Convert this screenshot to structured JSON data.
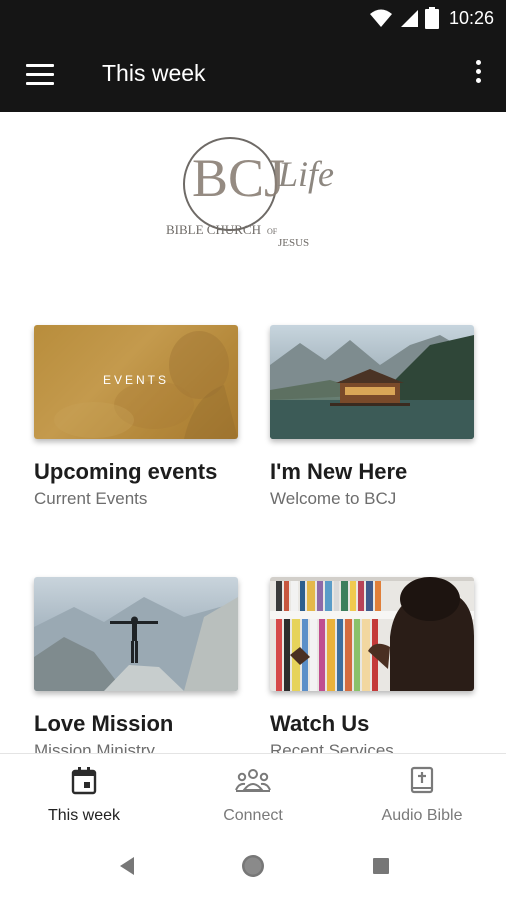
{
  "status_bar": {
    "time": "10:26",
    "icons": [
      "wifi-icon",
      "signal-icon",
      "battery-icon"
    ]
  },
  "app_bar": {
    "title": "This week",
    "menu_icon": "hamburger-menu-icon",
    "more_icon": "more-vert-icon"
  },
  "logo": {
    "monogram": "BCJ",
    "script_word": "Life",
    "line1": "BIBLE CHURCH",
    "line2": "OF",
    "line3": "JESUS"
  },
  "cards": [
    {
      "title": "Upcoming events",
      "subtitle": "Current Events",
      "image_label": "EVENTS"
    },
    {
      "title": "I'm New Here",
      "subtitle": "Welcome to BCJ"
    },
    {
      "title": "Love Mission",
      "subtitle": "Mission Ministry"
    },
    {
      "title": "Watch Us",
      "subtitle": "Recent Services"
    }
  ],
  "bottom_nav": {
    "items": [
      {
        "label": "This week",
        "icon": "calendar-icon",
        "active": true
      },
      {
        "label": "Connect",
        "icon": "people-icon",
        "active": false
      },
      {
        "label": "Audio Bible",
        "icon": "bible-icon",
        "active": false
      }
    ]
  },
  "system_nav": [
    "back-icon",
    "home-icon",
    "recents-icon"
  ],
  "colors": {
    "app_bar": "#151515",
    "title_text": "#1d1d1d",
    "subtitle_text": "#6d6d6d"
  }
}
